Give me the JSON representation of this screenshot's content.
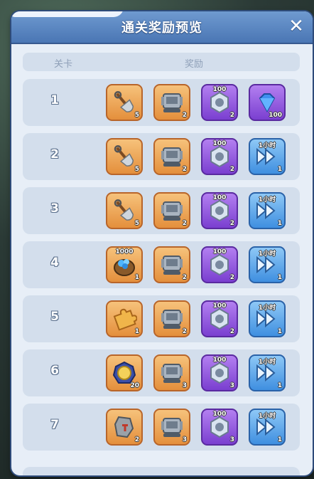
{
  "window": {
    "title": "通关奖励预览",
    "close_label": "✕"
  },
  "columns": {
    "level": "关卡",
    "reward": "奖励"
  },
  "rows": [
    {
      "level": "1",
      "rewards": [
        {
          "icon": "shovel-icon",
          "color": "orange",
          "qty": "5",
          "top": ""
        },
        {
          "icon": "machine-icon",
          "color": "orange",
          "qty": "2",
          "top": ""
        },
        {
          "icon": "gear-nut-icon",
          "color": "purple",
          "qty": "2",
          "top": "100"
        },
        {
          "icon": "diamond-icon",
          "color": "purple",
          "qty": "100",
          "top": ""
        }
      ]
    },
    {
      "level": "2",
      "rewards": [
        {
          "icon": "shovel-icon",
          "color": "orange",
          "qty": "5",
          "top": ""
        },
        {
          "icon": "machine-icon",
          "color": "orange",
          "qty": "2",
          "top": ""
        },
        {
          "icon": "gear-nut-icon",
          "color": "purple",
          "qty": "2",
          "top": "100"
        },
        {
          "icon": "fast-forward-icon",
          "color": "blue",
          "qty": "1",
          "top": "1小时"
        }
      ]
    },
    {
      "level": "3",
      "rewards": [
        {
          "icon": "shovel-icon",
          "color": "orange",
          "qty": "5",
          "top": ""
        },
        {
          "icon": "machine-icon",
          "color": "orange",
          "qty": "2",
          "top": ""
        },
        {
          "icon": "gear-nut-icon",
          "color": "purple",
          "qty": "2",
          "top": "100"
        },
        {
          "icon": "fast-forward-icon",
          "color": "blue",
          "qty": "1",
          "top": "1小时"
        }
      ]
    },
    {
      "level": "4",
      "rewards": [
        {
          "icon": "crystal-bag-icon",
          "color": "orange",
          "qty": "1",
          "top": "1000"
        },
        {
          "icon": "machine-icon",
          "color": "orange",
          "qty": "2",
          "top": ""
        },
        {
          "icon": "gear-nut-icon",
          "color": "purple",
          "qty": "2",
          "top": "100"
        },
        {
          "icon": "fast-forward-icon",
          "color": "blue",
          "qty": "1",
          "top": "1小时"
        }
      ]
    },
    {
      "level": "5",
      "rewards": [
        {
          "icon": "puzzle-piece-icon",
          "color": "orange",
          "qty": "1",
          "top": ""
        },
        {
          "icon": "machine-icon",
          "color": "orange",
          "qty": "2",
          "top": ""
        },
        {
          "icon": "gear-nut-icon",
          "color": "purple",
          "qty": "2",
          "top": "100"
        },
        {
          "icon": "fast-forward-icon",
          "color": "blue",
          "qty": "1",
          "top": "1小时"
        }
      ]
    },
    {
      "level": "6",
      "rewards": [
        {
          "icon": "medal-icon",
          "color": "orange",
          "qty": "20",
          "top": ""
        },
        {
          "icon": "machine-icon",
          "color": "orange",
          "qty": "3",
          "top": ""
        },
        {
          "icon": "gear-nut-icon",
          "color": "purple",
          "qty": "3",
          "top": "100"
        },
        {
          "icon": "fast-forward-icon",
          "color": "blue",
          "qty": "1",
          "top": "1小时"
        }
      ]
    },
    {
      "level": "7",
      "rewards": [
        {
          "icon": "ore-stone-icon",
          "color": "orange",
          "qty": "2",
          "top": ""
        },
        {
          "icon": "machine-icon",
          "color": "orange",
          "qty": "3",
          "top": ""
        },
        {
          "icon": "gear-nut-icon",
          "color": "purple",
          "qty": "3",
          "top": "100"
        },
        {
          "icon": "fast-forward-icon",
          "color": "blue",
          "qty": "1",
          "top": "1小时"
        }
      ]
    }
  ]
}
